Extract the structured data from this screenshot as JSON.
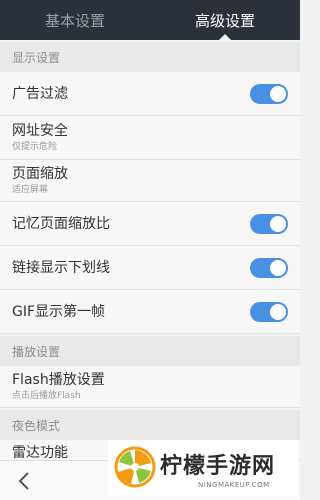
{
  "tabs": [
    {
      "label": "基本设置",
      "active": false
    },
    {
      "label": "高级设置",
      "active": true
    }
  ],
  "sections": {
    "display": "显示设置",
    "playback": "播放设置",
    "night": "夜色模式"
  },
  "rows": {
    "ad_filter": {
      "title": "广告过滤",
      "enabled": true
    },
    "url_security": {
      "title": "网址安全",
      "subtitle": "仅提示危险"
    },
    "page_zoom": {
      "title": "页面缩放",
      "subtitle": "适应屏幕"
    },
    "remember_zoom": {
      "title": "记忆页面缩放比",
      "enabled": true
    },
    "link_underline": {
      "title": "链接显示下划线",
      "enabled": true
    },
    "gif_first_frame": {
      "title": "GIF显示第一帧",
      "enabled": true
    },
    "flash": {
      "title": "Flash播放设置",
      "subtitle": "点击后播放Flash"
    },
    "radar": {
      "title": "雷达功能"
    }
  },
  "watermark": {
    "brand": "柠檬手游网",
    "url": "NINGMAKEUP.COM"
  },
  "colors": {
    "toggle_on": "#4a90e2",
    "tabbar": "#2c3038",
    "brand_orange": "#f39c12",
    "brand_green": "#8cc63f"
  },
  "icons": {
    "back": "chevron-left-icon",
    "logo": "lemon-logo-icon"
  }
}
